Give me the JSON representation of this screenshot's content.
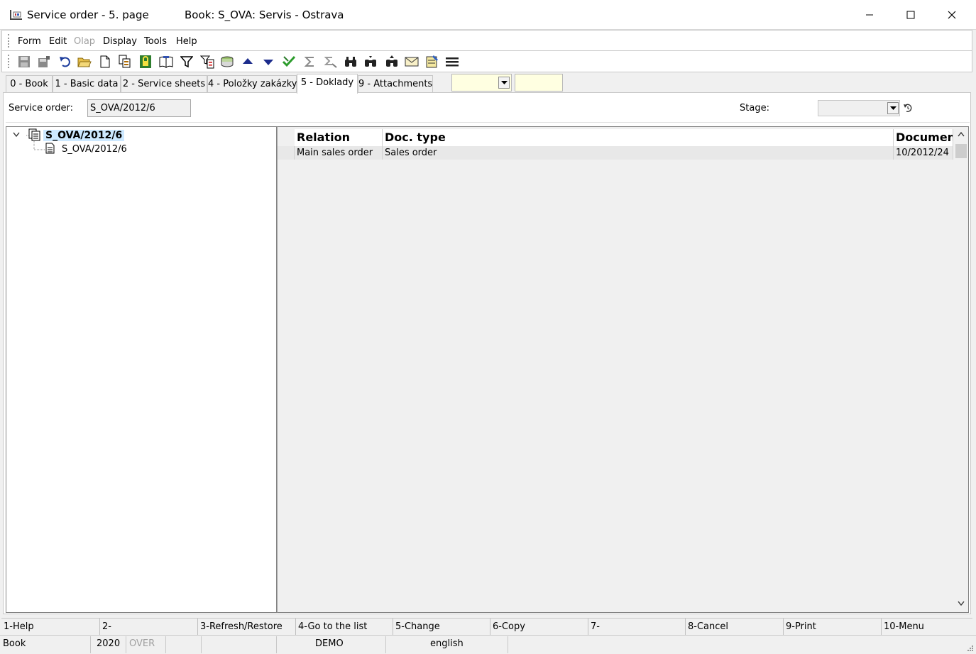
{
  "window": {
    "title": "Service order - 5. page",
    "book_title": "Book: S_OVA: Servis - Ostrava"
  },
  "menu": {
    "items": [
      {
        "label": "Form",
        "enabled": true
      },
      {
        "label": "Edit",
        "enabled": true
      },
      {
        "label": "Olap",
        "enabled": false
      },
      {
        "label": "Display",
        "enabled": true
      },
      {
        "label": "Tools",
        "enabled": true
      },
      {
        "label": "Help",
        "enabled": true
      }
    ]
  },
  "toolbar": {
    "icons": [
      "save-icon",
      "save-as-icon",
      "undo-icon",
      "open-folder-icon",
      "new-document-icon",
      "copy-icon",
      "lock-icon",
      "book-icon",
      "filter-icon",
      "filter-list-icon",
      "stack-icon",
      "arrow-up-icon",
      "arrow-down-icon",
      "check-icon",
      "sum-icon",
      "sum-disabled-icon",
      "binoculars-icon",
      "binoculars-down-icon",
      "binoculars-up-icon",
      "envelope-icon",
      "notes-icon",
      "menu-lines-icon"
    ]
  },
  "tabs": [
    {
      "label": "0 - Book",
      "active": false
    },
    {
      "label": "1 - Basic data",
      "active": false
    },
    {
      "label": "2 - Service sheets",
      "active": false
    },
    {
      "label": "4 - Položky zakázky",
      "active": false
    },
    {
      "label": "5 - Doklady",
      "active": true
    },
    {
      "label": "9 - Attachments",
      "active": false
    }
  ],
  "form": {
    "service_order_label": "Service order:",
    "service_order_value": "S_OVA/2012/6",
    "stage_label": "Stage:",
    "stage_value": ""
  },
  "tree": {
    "root": "S_OVA/2012/6",
    "children": [
      "S_OVA/2012/6"
    ]
  },
  "grid": {
    "columns": [
      "Relation",
      "Doc. type",
      "Document"
    ],
    "rows": [
      [
        "Main sales order",
        "Sales order",
        "10/2012/24"
      ]
    ]
  },
  "fkeys": [
    "1-Help",
    "2-",
    "3-Refresh/Restore",
    "4-Go to the list",
    "5-Change",
    "6-Copy",
    "7-",
    "8-Cancel",
    "9-Print",
    "10-Menu"
  ],
  "status": {
    "book": "Book",
    "year": "2020",
    "mode": "OVER",
    "db": "DEMO",
    "language": "english"
  },
  "colors": {
    "highlight_field": "#ffffe1",
    "selection": "#cce8ff",
    "panel": "#f0f0f0"
  }
}
